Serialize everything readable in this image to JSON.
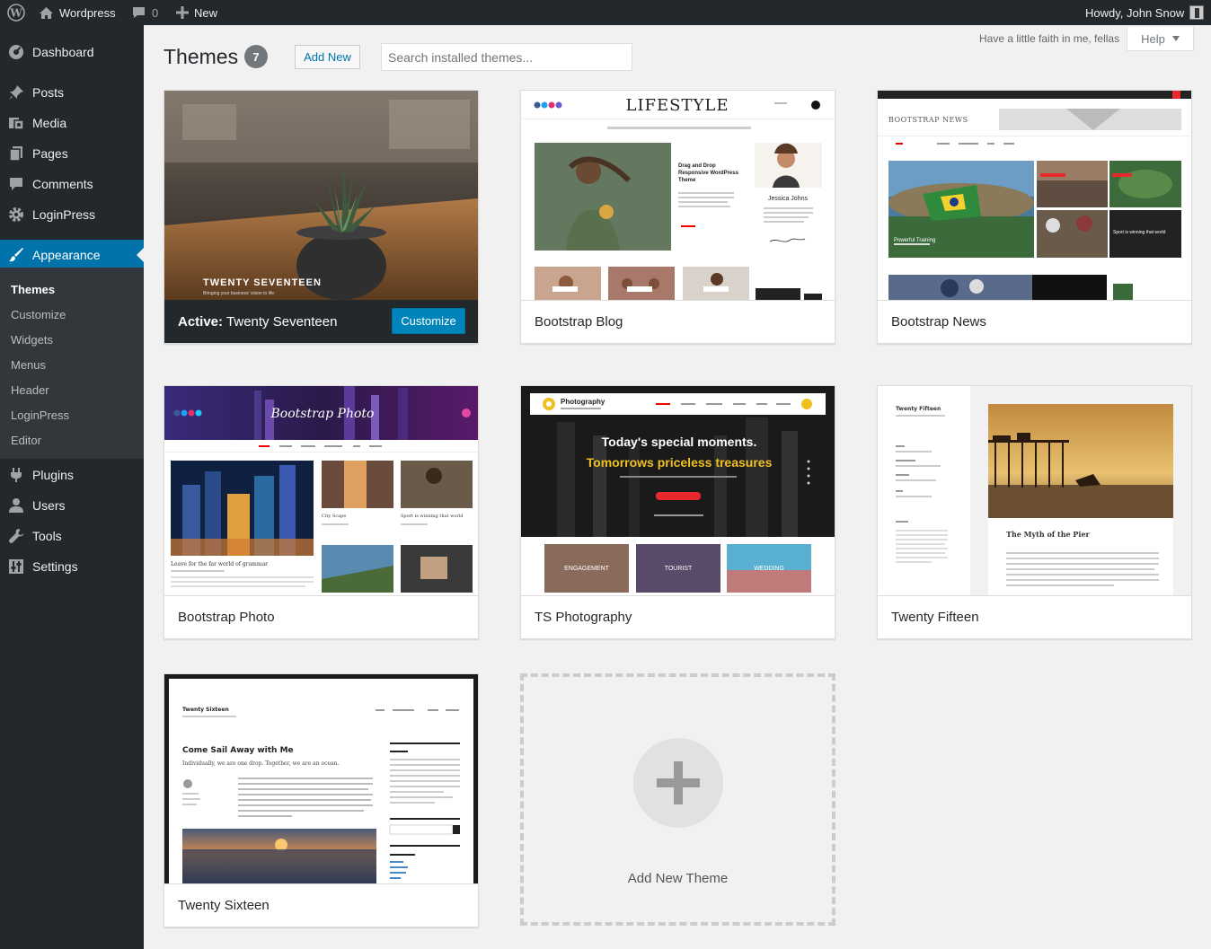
{
  "adminbar": {
    "site_name": "Wordpress",
    "comments_count": "0",
    "new_label": "New",
    "howdy": "Howdy, John Snow"
  },
  "sidebar": {
    "items": [
      {
        "label": "Dashboard",
        "icon": "dashboard-icon"
      },
      {
        "label": "Posts",
        "icon": "pin-icon"
      },
      {
        "label": "Media",
        "icon": "media-icon"
      },
      {
        "label": "Pages",
        "icon": "pages-icon"
      },
      {
        "label": "Comments",
        "icon": "comment-icon"
      },
      {
        "label": "LoginPress",
        "icon": "gear-icon"
      },
      {
        "label": "Appearance",
        "icon": "brush-icon"
      },
      {
        "label": "Plugins",
        "icon": "plug-icon"
      },
      {
        "label": "Users",
        "icon": "user-icon"
      },
      {
        "label": "Tools",
        "icon": "wrench-icon"
      },
      {
        "label": "Settings",
        "icon": "settings-icon"
      }
    ],
    "submenu": [
      "Themes",
      "Customize",
      "Widgets",
      "Menus",
      "Header",
      "LoginPress",
      "Editor"
    ]
  },
  "header": {
    "title": "Themes",
    "count": "7",
    "add_new": "Add New",
    "search_placeholder": "Search installed themes...",
    "faith": "Have a little faith in me, fellas",
    "help": "Help"
  },
  "themes": [
    {
      "name": "Twenty Seventeen",
      "active_label": "Active:",
      "customize": "Customize",
      "shot_title": "TWENTY SEVENTEEN",
      "shot_sub": "Bringing your business' vision to life"
    },
    {
      "name": "Bootstrap Blog",
      "shot_title": "LIFESTYLE",
      "shot_post": "Drag and Drop Responsive WordPress Theme",
      "shot_author": "Jessica Johns"
    },
    {
      "name": "Bootstrap News",
      "shot_title": "BOOTSTRAP NEWS",
      "shot_story1": "Powerful Training",
      "shot_story2": "Sport is winning that world"
    },
    {
      "name": "Bootstrap Photo",
      "shot_title": "Bootstrap Photo",
      "shot_post": "Leave for the far world of grammar",
      "shot_side1": "City Scape",
      "shot_side2": "Sport is winning that world"
    },
    {
      "name": "TS Photography",
      "shot_logo": "Photography",
      "shot_line1": "Today's special moments.",
      "shot_line2": "Tomorrows priceless treasures",
      "shot_tile1": "ENGAGEMENT",
      "shot_tile2": "TOURIST",
      "shot_tile3": "WEDDING"
    },
    {
      "name": "Twenty Fifteen",
      "shot_site": "Twenty Fifteen",
      "shot_post": "The Myth of the Pier"
    },
    {
      "name": "Twenty Sixteen",
      "shot_site": "Twenty Sixteen",
      "shot_post": "Come Sail Away with Me",
      "shot_sub": "Individually, we are one drop. Together, we are an ocean."
    }
  ],
  "add_new_theme": "Add New Theme",
  "colors": {
    "admin_dark": "#23282d",
    "accent": "#0073aa",
    "button": "#0085ba"
  }
}
